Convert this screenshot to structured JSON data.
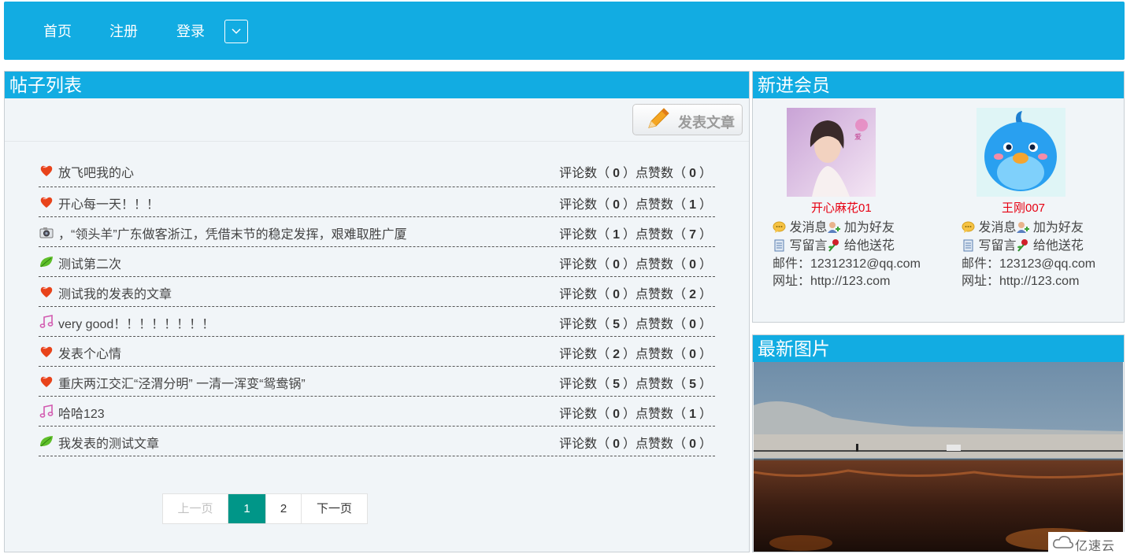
{
  "nav": {
    "items": [
      "首页",
      "注册",
      "登录"
    ],
    "toggle_icon": "chevron-down-icon"
  },
  "posts_panel": {
    "title": "帖子列表",
    "post_button": "发表文章",
    "comment_label": "评论数",
    "like_label": "点赞数",
    "posts": [
      {
        "icon": "heart-icon",
        "title": "放飞吧我的心",
        "comments": "0",
        "likes": "0"
      },
      {
        "icon": "heart-icon",
        "title": "开心每一天！！！",
        "comments": "0",
        "likes": "1"
      },
      {
        "icon": "camera-icon",
        "title": "，“领头羊”广东做客浙江，凭借末节的稳定发挥，艰难取胜广厦",
        "comments": "1",
        "likes": "7"
      },
      {
        "icon": "leaf-icon",
        "title": "测试第二次",
        "comments": "0",
        "likes": "0"
      },
      {
        "icon": "heart-icon",
        "title": "测试我的发表的文章",
        "comments": "0",
        "likes": "2"
      },
      {
        "icon": "music-note-icon",
        "title": "very good！！！！！！！！",
        "comments": "5",
        "likes": "0"
      },
      {
        "icon": "heart-icon",
        "title": "发表个心情",
        "comments": "2",
        "likes": "0"
      },
      {
        "icon": "heart-icon",
        "title": "重庆两江交汇“泾渭分明” 一清一浑变“鸳鸯锅”",
        "comments": "5",
        "likes": "5"
      },
      {
        "icon": "music-note-icon",
        "title": "哈哈123",
        "comments": "0",
        "likes": "1"
      },
      {
        "icon": "leaf-icon",
        "title": "我发表的测试文章",
        "comments": "0",
        "likes": "0"
      }
    ],
    "pagination": {
      "prev": "上一页",
      "pages": [
        "1",
        "2"
      ],
      "current": "1",
      "next": "下一页"
    }
  },
  "members_panel": {
    "title": "新进会员",
    "members": [
      {
        "name": "开心麻花01",
        "message": "发消息",
        "add_friend": "加为好友",
        "guestbook": "写留言",
        "flower": "给他送花",
        "email": "邮件：12312312@qq.com",
        "website": "网址：http://123.com"
      },
      {
        "name": "王刚007",
        "message": "发消息",
        "add_friend": "加为好友",
        "guestbook": "写留言",
        "flower": "给他送花",
        "email": "邮件：123123@qq.com",
        "website": "网址：http://123.com"
      }
    ]
  },
  "photos_panel": {
    "title": "最新图片"
  },
  "watermark": {
    "text": "亿速云"
  },
  "colors": {
    "accent": "#12ace2",
    "pager_current": "#009688",
    "member_name": "#e60012",
    "panel_bg": "#f1f5f8"
  }
}
